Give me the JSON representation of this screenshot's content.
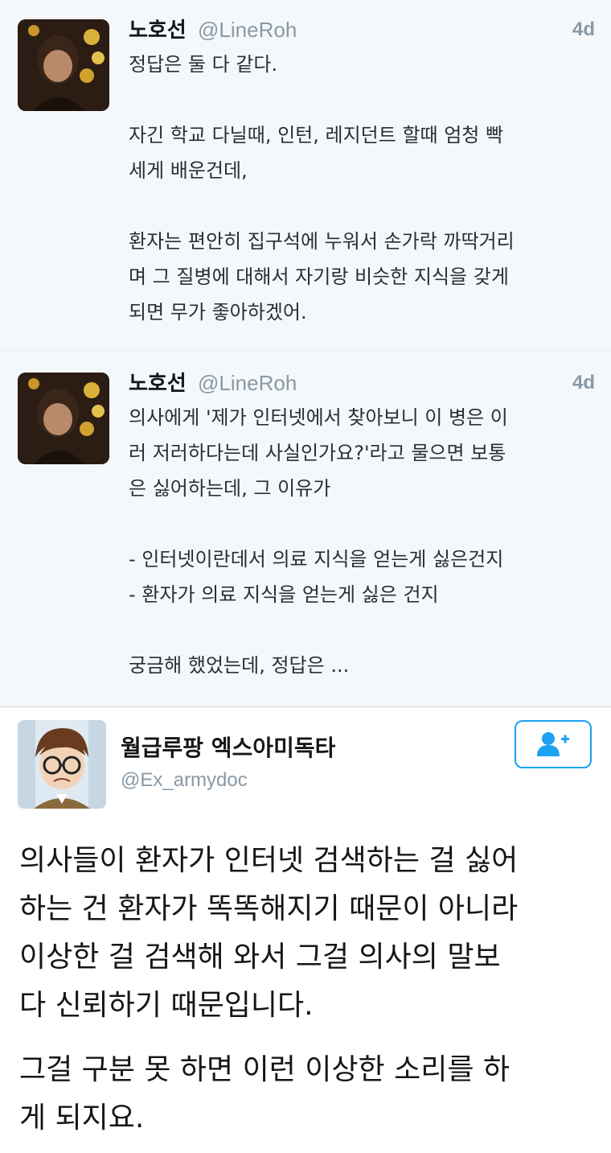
{
  "tweets": [
    {
      "name": "노호선",
      "handle": "@LineRoh",
      "time": "4d",
      "lines": [
        "정답은 둘 다 같다.",
        "",
        "자긴 학교 다닐때, 인턴, 레지던트 할때 엄청 빡",
        "세게 배운건데,",
        "",
        "환자는 편안히 집구석에 누워서 손가락 까딱거리",
        "며 그 질병에 대해서 자기랑 비슷한 지식을 갖게",
        "되면 무가 좋아하겠어."
      ]
    },
    {
      "name": "노호선",
      "handle": "@LineRoh",
      "time": "4d",
      "lines": [
        "의사에게 '제가 인터넷에서 찾아보니 이 병은 이",
        "러 저러하다는데 사실인가요?'라고 물으면 보통",
        "은 싫어하는데, 그 이유가",
        "",
        "- 인터넷이란데서 의료 지식을 얻는게 싫은건지",
        "- 환자가 의료 지식을 얻는게 싫은 건지",
        "",
        "궁금해 했었는데, 정답은 ..."
      ]
    }
  ],
  "reply": {
    "name": "월급루팡 엑스아미독타",
    "handle": "@Ex_armydoc",
    "follow_icon": "follow-user-icon",
    "lines_p1": [
      "의사들이 환자가 인터넷 검색하는 걸 싫어",
      "하는 건 환자가 똑똑해지기 때문이 아니라",
      "이상한 걸 검색해 와서 그걸 의사의 말보",
      "다 신뢰하기 때문입니다."
    ],
    "lines_p2": [
      "그걸 구분 못 하면 이런 이상한 소리를 하",
      "게 되지요."
    ]
  },
  "colors": {
    "accent": "#1da1f2",
    "muted": "#8899a6",
    "tweet_bg": "#f5f8fa"
  }
}
